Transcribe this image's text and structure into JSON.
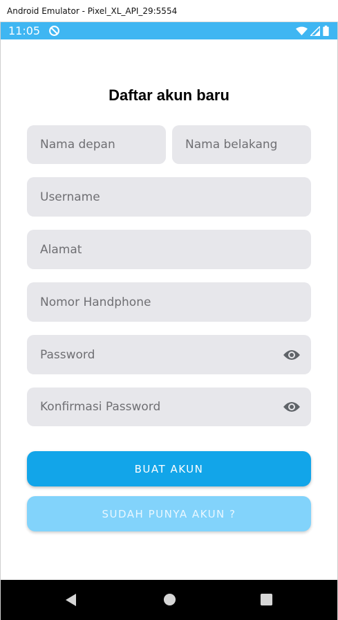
{
  "window": {
    "title": "Android Emulator - Pixel_XL_API_29:5554"
  },
  "status_bar": {
    "time": "11:05",
    "color": "#3fb6f2",
    "icons": [
      "data-saver-icon",
      "wifi-icon",
      "cell-signal-icon",
      "battery-icon"
    ]
  },
  "page": {
    "title": "Daftar akun baru"
  },
  "form": {
    "first_name_placeholder": "Nama depan",
    "last_name_placeholder": "Nama belakang",
    "username_placeholder": "Username",
    "address_placeholder": "Alamat",
    "phone_placeholder": "Nomor Handphone",
    "password_placeholder": "Password",
    "confirm_password_placeholder": "Konfirmasi Password",
    "field_color": "#e7e7eb"
  },
  "buttons": {
    "create_account": "BUAT AKUN",
    "already_have_account": "SUDAH PUNYA AKUN ?",
    "primary_color": "#12a5e9",
    "secondary_color": "#82d3fb"
  },
  "nav_bar": {
    "icons": [
      "back-icon",
      "home-icon",
      "recents-icon"
    ]
  }
}
